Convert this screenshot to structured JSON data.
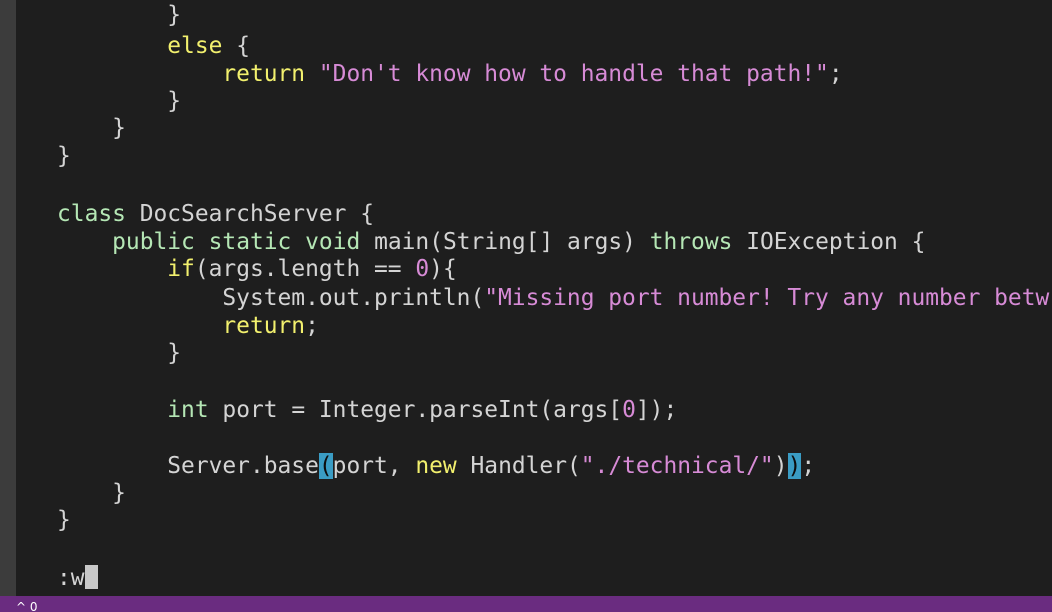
{
  "editor": {
    "lines": [
      {
        "id": "l1",
        "segments": [
          {
            "t": "        }",
            "c": "plain"
          }
        ]
      },
      {
        "id": "l2",
        "segments": [
          {
            "t": "        ",
            "c": "plain"
          },
          {
            "t": "else",
            "c": "kw-yellow"
          },
          {
            "t": " {",
            "c": "plain"
          }
        ]
      },
      {
        "id": "l3",
        "segments": [
          {
            "t": "            ",
            "c": "plain"
          },
          {
            "t": "return",
            "c": "kw-yellow"
          },
          {
            "t": " ",
            "c": "plain"
          },
          {
            "t": "\"Don't know how to handle that path!\"",
            "c": "str"
          },
          {
            "t": ";",
            "c": "plain"
          }
        ]
      },
      {
        "id": "l4",
        "segments": [
          {
            "t": "        }",
            "c": "plain"
          }
        ]
      },
      {
        "id": "l5",
        "segments": [
          {
            "t": "    }",
            "c": "plain"
          }
        ]
      },
      {
        "id": "l6",
        "segments": [
          {
            "t": "}",
            "c": "plain"
          }
        ]
      },
      {
        "id": "l7",
        "segments": []
      },
      {
        "id": "l8",
        "segments": [
          {
            "t": "class",
            "c": "kw-green"
          },
          {
            "t": " DocSearchServer {",
            "c": "plain"
          }
        ]
      },
      {
        "id": "l9",
        "segments": [
          {
            "t": "    ",
            "c": "plain"
          },
          {
            "t": "public",
            "c": "kw-green"
          },
          {
            "t": " ",
            "c": "plain"
          },
          {
            "t": "static",
            "c": "kw-green"
          },
          {
            "t": " ",
            "c": "plain"
          },
          {
            "t": "void",
            "c": "kw-green"
          },
          {
            "t": " main(String[] args) ",
            "c": "plain"
          },
          {
            "t": "throws",
            "c": "kw-green"
          },
          {
            "t": " IOException {",
            "c": "plain"
          }
        ]
      },
      {
        "id": "l10",
        "segments": [
          {
            "t": "        ",
            "c": "plain"
          },
          {
            "t": "if",
            "c": "kw-yellow"
          },
          {
            "t": "(args.length == ",
            "c": "plain"
          },
          {
            "t": "0",
            "c": "num"
          },
          {
            "t": "){",
            "c": "plain"
          }
        ]
      },
      {
        "id": "l11",
        "segments": [
          {
            "t": "            System.out.println(",
            "c": "plain"
          },
          {
            "t": "\"Missing port number! Try any number betw",
            "c": "str"
          }
        ]
      },
      {
        "id": "l12",
        "segments": [
          {
            "t": "            ",
            "c": "plain"
          },
          {
            "t": "return",
            "c": "kw-yellow"
          },
          {
            "t": ";",
            "c": "plain"
          }
        ]
      },
      {
        "id": "l13",
        "segments": [
          {
            "t": "        }",
            "c": "plain"
          }
        ]
      },
      {
        "id": "l14",
        "segments": []
      },
      {
        "id": "l15",
        "segments": [
          {
            "t": "        ",
            "c": "plain"
          },
          {
            "t": "int",
            "c": "kw-green"
          },
          {
            "t": " port = Integer.parseInt(args[",
            "c": "plain"
          },
          {
            "t": "0",
            "c": "num"
          },
          {
            "t": "]);",
            "c": "plain"
          }
        ]
      },
      {
        "id": "l16",
        "segments": []
      },
      {
        "id": "l17",
        "segments": [
          {
            "t": "        Server.base",
            "c": "plain"
          },
          {
            "t": "(",
            "c": "match"
          },
          {
            "t": "port, ",
            "c": "plain"
          },
          {
            "t": "new",
            "c": "kw-yellow"
          },
          {
            "t": " Handler(",
            "c": "plain"
          },
          {
            "t": "\"./technical/\"",
            "c": "str"
          },
          {
            "t": ")",
            "c": "plain"
          },
          {
            "t": ")",
            "c": "match"
          },
          {
            "t": ";",
            "c": "plain"
          }
        ]
      },
      {
        "id": "l18",
        "segments": [
          {
            "t": "    }",
            "c": "plain"
          }
        ]
      },
      {
        "id": "l19",
        "segments": [
          {
            "t": "}",
            "c": "plain"
          }
        ]
      }
    ]
  },
  "command_line": {
    "text": ":w"
  },
  "status_bar": {
    "glyph": "^ 0"
  }
}
